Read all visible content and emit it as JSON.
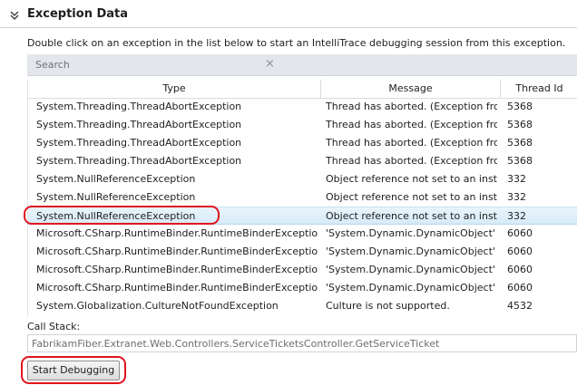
{
  "section": {
    "title": "Exception Data",
    "icon": "chevron-collapse-icon"
  },
  "instructions": "Double click on an exception in the list below to start an IntelliTrace debugging session from this exception.",
  "search": {
    "placeholder": "Search",
    "clear_icon": "close-icon"
  },
  "table": {
    "columns": [
      "Type",
      "Message",
      "Thread Id"
    ],
    "selected_row": 6,
    "rows": [
      {
        "type": "System.Threading.ThreadAbortException",
        "message": "Thread has aborted. (Exception from",
        "thread_id": "5368"
      },
      {
        "type": "System.Threading.ThreadAbortException",
        "message": "Thread has aborted. (Exception from",
        "thread_id": "5368"
      },
      {
        "type": "System.Threading.ThreadAbortException",
        "message": "Thread has aborted. (Exception from",
        "thread_id": "5368"
      },
      {
        "type": "System.Threading.ThreadAbortException",
        "message": "Thread has aborted. (Exception from",
        "thread_id": "5368"
      },
      {
        "type": "System.NullReferenceException",
        "message": "Object reference not set to an instar",
        "thread_id": "332"
      },
      {
        "type": "System.NullReferenceException",
        "message": "Object reference not set to an instar",
        "thread_id": "332"
      },
      {
        "type": "System.NullReferenceException",
        "message": "Object reference not set to an instar",
        "thread_id": "332"
      },
      {
        "type": "Microsoft.CSharp.RuntimeBinder.RuntimeBinderException",
        "message": "'System.Dynamic.DynamicObject' d",
        "thread_id": "6060"
      },
      {
        "type": "Microsoft.CSharp.RuntimeBinder.RuntimeBinderException",
        "message": "'System.Dynamic.DynamicObject' d",
        "thread_id": "6060"
      },
      {
        "type": "Microsoft.CSharp.RuntimeBinder.RuntimeBinderException",
        "message": "'System.Dynamic.DynamicObject' d",
        "thread_id": "6060"
      },
      {
        "type": "Microsoft.CSharp.RuntimeBinder.RuntimeBinderException",
        "message": "'System.Dynamic.DynamicObject' d",
        "thread_id": "6060"
      },
      {
        "type": "System.Globalization.CultureNotFoundException",
        "message": "Culture is not supported.",
        "thread_id": "4532"
      }
    ]
  },
  "call_stack": {
    "label": "Call Stack:",
    "value": "FabrikamFiber.Extranet.Web.Controllers.ServiceTicketsController.GetServiceTicket"
  },
  "start_button": {
    "label": "Start Debugging"
  },
  "colors": {
    "annotation": "#e0141e",
    "selection": "#d6ebf8"
  }
}
